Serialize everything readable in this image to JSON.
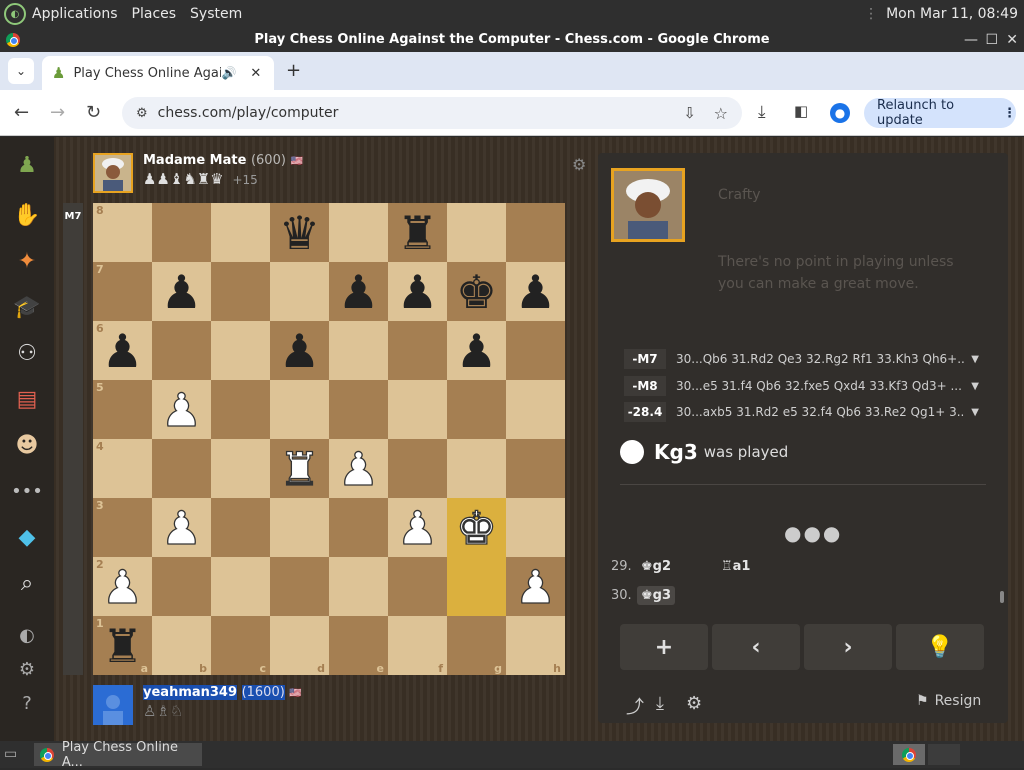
{
  "topbar": {
    "menus": [
      "Applications",
      "Places",
      "System"
    ],
    "clock": "Mon Mar 11, 08:49"
  },
  "window": {
    "title": "Play Chess Online Against the Computer - Chess.com - Google Chrome"
  },
  "tab": {
    "label": "Play Chess Online Agains"
  },
  "address": {
    "url": "chess.com/play/computer",
    "relaunch": "Relaunch to update"
  },
  "opponent": {
    "name": "Madame Mate",
    "rating": "(600)",
    "captured": "♟♟♝♞♜♛",
    "advantage": "+15"
  },
  "user": {
    "name": "yeahman349",
    "rating": "(1600)",
    "captured": "♙♗♘"
  },
  "evalbar": {
    "label": "M7"
  },
  "board": {
    "ranks": [
      "8",
      "7",
      "6",
      "5",
      "4",
      "3",
      "2",
      "1"
    ],
    "files": [
      "a",
      "b",
      "c",
      "d",
      "e",
      "f",
      "g",
      "h"
    ],
    "rows": [
      [
        "",
        "",
        "",
        "bq",
        "",
        "br",
        "",
        ""
      ],
      [
        "",
        "bp",
        "",
        "",
        "bp",
        "bp",
        "bk",
        "bp"
      ],
      [
        "bp",
        "",
        "",
        "bp",
        "",
        "",
        "bp",
        ""
      ],
      [
        "",
        "wp",
        "",
        "",
        "",
        "",
        "",
        ""
      ],
      [
        "",
        "",
        "",
        "wr",
        "wp",
        "",
        "",
        ""
      ],
      [
        "",
        "wp",
        "",
        "",
        "",
        "wp",
        "wk",
        ""
      ],
      [
        "wp",
        "",
        "",
        "",
        "",
        "",
        "",
        "wp"
      ],
      [
        "br",
        "",
        "",
        "",
        "",
        "",
        "",
        ""
      ]
    ]
  },
  "panel": {
    "bot_name": "Crafty",
    "bot_message": "There's no point in playing unless you can make a great move.",
    "engine_lines": [
      {
        "eval": "-M7",
        "moves": "30...Qb6 31.Rd2 Qe3 32.Rg2 Rf1 33.Kh3 Qh6+..."
      },
      {
        "eval": "-M8",
        "moves": "30...e5 31.f4 Qb6 32.fxe5 Qxd4 33.Kf3 Qd3+ ..."
      },
      {
        "eval": "-28.4",
        "moves": "30...axb5 31.Rd2 e5 32.f4 Qb6 33.Re2 Qg1+ 3..."
      }
    ],
    "played_move": "Kg3",
    "played_suffix": "was played",
    "movelist": [
      {
        "num": "29.",
        "white": "♚g2",
        "black": "♖a1"
      },
      {
        "num": "30.",
        "white": "♚g3",
        "black": ""
      }
    ],
    "resign": "Resign"
  },
  "taskbar": {
    "item": "Play Chess Online A..."
  }
}
